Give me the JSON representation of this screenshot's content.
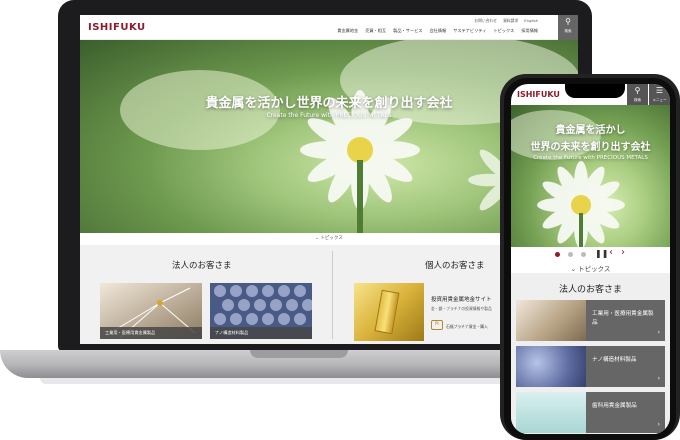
{
  "laptop": {
    "logo": "ISHIFUKU",
    "utility_links": [
      "お問い合わせ",
      "資料請求",
      "English"
    ],
    "nav": [
      "貴金属地金",
      "売買・相互",
      "製品・サービス",
      "会社情報",
      "サステナビリティ",
      "トピックス",
      "採用情報"
    ],
    "search_label": "検索",
    "hero": {
      "title": "貴金属を活かし世界の未来を創り出す会社",
      "subtitle": "Create the Future with PRECIOUS METALS"
    },
    "topics_label": "トピックス",
    "corporate": {
      "heading": "法人のお客さま",
      "tiles": [
        {
          "label": "工業用・医療用貴金属製品"
        },
        {
          "label": "ナノ構造材料製品"
        }
      ]
    },
    "individual": {
      "heading": "個人のお客さま",
      "title": "投資用貴金属地金サイト",
      "desc": "金・銀・プラチナの投資情報や製品",
      "sub_link": "石福プラチナ資金・購入"
    }
  },
  "phone": {
    "logo": "ISHIFUKU",
    "search_label": "検索",
    "menu_label": "メニュー",
    "hero": {
      "title_line1": "貴金属を活かし",
      "title_line2": "世界の未来を創り出す会社",
      "subtitle": "Create the Future with PRECIOUS METALS"
    },
    "topics_label": "トピックス",
    "corporate_heading": "法人のお客さま",
    "tiles": [
      {
        "label": "工業用・医療用貴金属製品"
      },
      {
        "label": "ナノ構造材料製品"
      },
      {
        "label": "歯科用貴金属製品"
      }
    ]
  },
  "colors": {
    "brand": "#8b1c2c",
    "dark_panel": "#666666",
    "hero_green": "#9ec47a"
  }
}
